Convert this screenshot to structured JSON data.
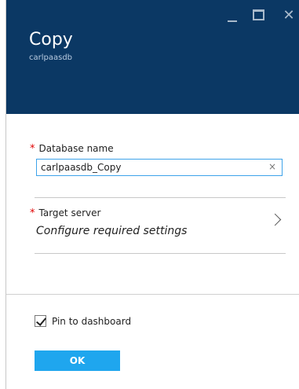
{
  "header": {
    "title": "Copy",
    "subtitle": "carlpaasdb",
    "background": "#0b3864"
  },
  "window_controls": {
    "minimize_icon": "minimize-icon",
    "maximize_icon": "maximize-icon",
    "close_icon": "close-icon",
    "close_glyph": "✕"
  },
  "form": {
    "required_marker": "*",
    "database_name": {
      "label": "Database name",
      "value": "carlpaasdb_Copy",
      "clear_glyph": "×"
    },
    "target_server": {
      "label": "Target server",
      "value": "Configure required settings"
    },
    "pin_to_dashboard": {
      "label": "Pin to dashboard",
      "checked": true
    },
    "ok_label": "OK"
  },
  "colors": {
    "accent": "#1fa6ee",
    "required": "#e00000",
    "input_focus_border": "#3ea3ea"
  }
}
